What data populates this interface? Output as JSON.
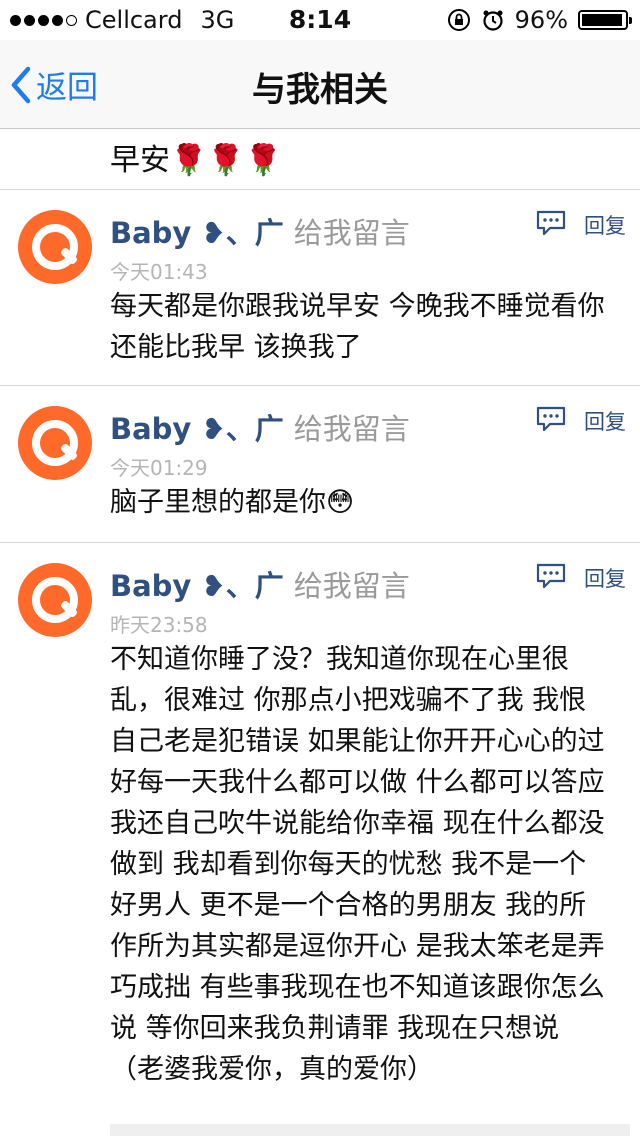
{
  "status_bar": {
    "carrier": "Cellcard",
    "network": "3G",
    "time": "8:14",
    "battery": "96%",
    "battery_level": 0.96
  },
  "nav": {
    "back_label": "返回",
    "title": "与我相关"
  },
  "partial_post": {
    "text": "早安🌹🌹🌹"
  },
  "posts": [
    {
      "name": "Baby ❥、广",
      "action": "给我留言",
      "time": "今天01:43",
      "body": "每天都是你跟我说早安 今晚我不睡觉看你还能比我早 该换我了",
      "reply_label": "回复"
    },
    {
      "name": "Baby ❥、广",
      "action": "给我留言",
      "time": "今天01:29",
      "body": "脑子里想的都是你😳",
      "reply_label": "回复"
    },
    {
      "name": "Baby ❥、广",
      "action": "给我留言",
      "time": "昨天23:58",
      "body": "不知道你睡了没？我知道你现在心里很乱，很难过 你那点小把戏骗不了我 我恨自己老是犯错误 如果能让你开开心心的过好每一天我什么都可以做 什么都可以答应 我还自己吹牛说能给你幸福 现在什么都没做到 我却看到你每天的忧愁 我不是一个好男人 更不是一个合格的男朋友 我的所作所为其实都是逗你开心 是我太笨老是弄巧成拙 有些事我现在也不知道该跟你怎么说 等你回来我负荆请罪 我现在只想说（老婆我爱你，真的爱你）",
      "reply_label": "回复"
    }
  ]
}
